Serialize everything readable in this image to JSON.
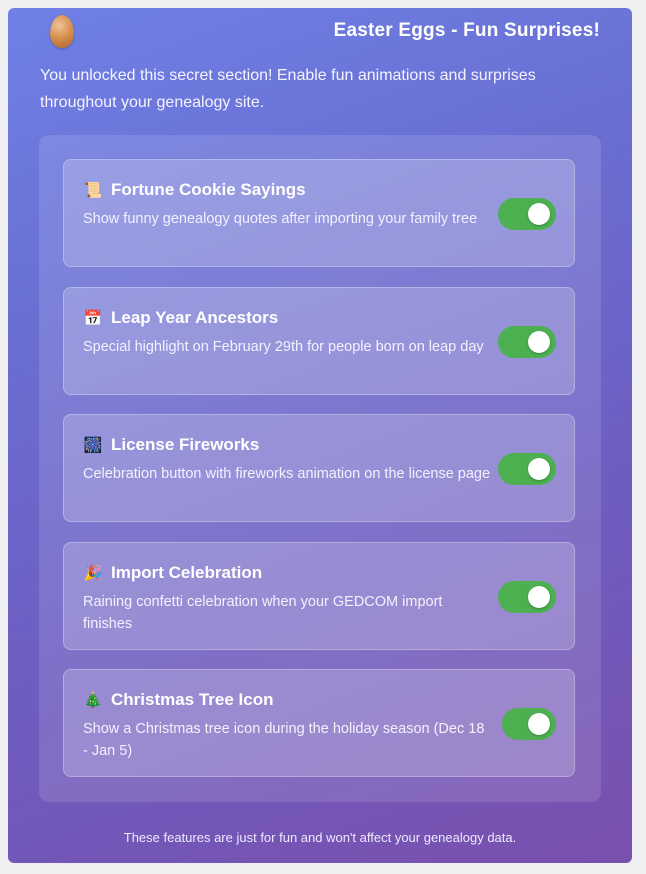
{
  "header": {
    "icon": "egg-icon",
    "title": "Easter Eggs - Fun Surprises!"
  },
  "intro": "You unlocked this secret section! Enable fun animations and surprises throughout your genealogy site.",
  "features": [
    {
      "icon": "scroll-icon",
      "glyph": "📜",
      "title": "Fortune Cookie Sayings",
      "description": "Show funny genealogy quotes after importing your family tree",
      "enabled": true
    },
    {
      "icon": "calendar-icon",
      "glyph": "📅",
      "title": "Leap Year Ancestors",
      "description": "Special highlight on February 29th for people born on leap day",
      "enabled": true
    },
    {
      "icon": "fireworks-icon",
      "glyph": "🎆",
      "title": "License Fireworks",
      "description": "Celebration button with fireworks animation on the license page",
      "enabled": true
    },
    {
      "icon": "party-popper-icon",
      "glyph": "🎉",
      "title": "Import Celebration",
      "description": "Raining confetti celebration when your GEDCOM import finishes",
      "enabled": true
    },
    {
      "icon": "christmas-tree-icon",
      "glyph": "🎄",
      "title": "Christmas Tree Icon",
      "description": "Show a Christmas tree icon during the holiday season (Dec 18 - Jan 5)",
      "enabled": true
    }
  ],
  "footer": "These features are just for fun and won't affect your genealogy data.",
  "colors": {
    "toggle_on": "#4caf50",
    "panel_gradient_start": "#6f80e6",
    "panel_gradient_end": "#7a50ad"
  }
}
